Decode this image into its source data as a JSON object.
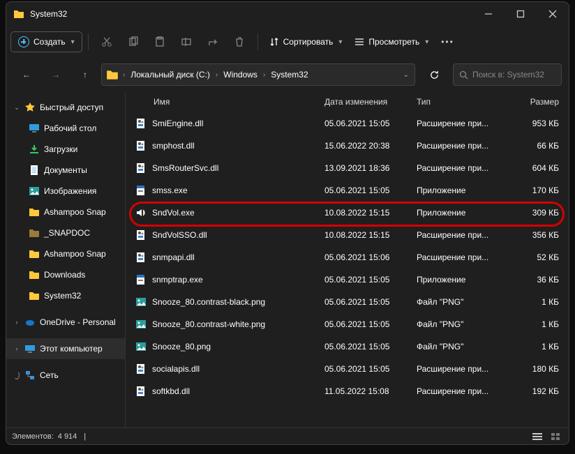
{
  "title": "System32",
  "cmd": {
    "create": "Создать",
    "sort": "Сортировать",
    "view": "Просмотреть"
  },
  "breadcrumbs": [
    "Локальный диск (C:)",
    "Windows",
    "System32"
  ],
  "search_placeholder": "Поиск в: System32",
  "cols": {
    "name": "Имя",
    "date": "Дата изменения",
    "type": "Тип",
    "size": "Размер"
  },
  "sidebar": {
    "quick": "Быстрый доступ",
    "items": [
      {
        "label": "Рабочий стол",
        "icon": "desktop"
      },
      {
        "label": "Загрузки",
        "icon": "download"
      },
      {
        "label": "Документы",
        "icon": "document"
      },
      {
        "label": "Изображения",
        "icon": "image"
      },
      {
        "label": "Ashampoo Snap",
        "icon": "folder"
      },
      {
        "label": "_SNAPDOC",
        "icon": "folder-dark"
      },
      {
        "label": "Ashampoo Snap",
        "icon": "folder"
      },
      {
        "label": "Downloads",
        "icon": "folder"
      },
      {
        "label": "System32",
        "icon": "folder"
      }
    ],
    "onedrive": "OneDrive - Personal",
    "thispc": "Этот компьютер",
    "network": "Сеть"
  },
  "files": [
    {
      "name": "SmiEngine.dll",
      "date": "05.06.2021 15:05",
      "type": "Расширение при...",
      "size": "953 КБ",
      "icon": "dll"
    },
    {
      "name": "smphost.dll",
      "date": "15.06.2022 20:38",
      "type": "Расширение при...",
      "size": "66 КБ",
      "icon": "dll"
    },
    {
      "name": "SmsRouterSvc.dll",
      "date": "13.09.2021 18:36",
      "type": "Расширение при...",
      "size": "604 КБ",
      "icon": "dll"
    },
    {
      "name": "smss.exe",
      "date": "05.06.2021 15:05",
      "type": "Приложение",
      "size": "170 КБ",
      "icon": "exe"
    },
    {
      "name": "SndVol.exe",
      "date": "10.08.2022 15:15",
      "type": "Приложение",
      "size": "309 КБ",
      "icon": "speaker"
    },
    {
      "name": "SndVolSSO.dll",
      "date": "10.08.2022 15:15",
      "type": "Расширение при...",
      "size": "356 КБ",
      "icon": "dll"
    },
    {
      "name": "snmpapi.dll",
      "date": "05.06.2021 15:06",
      "type": "Расширение при...",
      "size": "52 КБ",
      "icon": "dll"
    },
    {
      "name": "snmptrap.exe",
      "date": "05.06.2021 15:05",
      "type": "Приложение",
      "size": "36 КБ",
      "icon": "exe"
    },
    {
      "name": "Snooze_80.contrast-black.png",
      "date": "05.06.2021 15:05",
      "type": "Файл \"PNG\"",
      "size": "1 КБ",
      "icon": "png"
    },
    {
      "name": "Snooze_80.contrast-white.png",
      "date": "05.06.2021 15:05",
      "type": "Файл \"PNG\"",
      "size": "1 КБ",
      "icon": "png"
    },
    {
      "name": "Snooze_80.png",
      "date": "05.06.2021 15:05",
      "type": "Файл \"PNG\"",
      "size": "1 КБ",
      "icon": "png"
    },
    {
      "name": "socialapis.dll",
      "date": "05.06.2021 15:05",
      "type": "Расширение при...",
      "size": "180 КБ",
      "icon": "dll"
    },
    {
      "name": "softkbd.dll",
      "date": "11.05.2022 15:08",
      "type": "Расширение при...",
      "size": "192 КБ",
      "icon": "dll"
    }
  ],
  "status": {
    "label": "Элементов:",
    "count": "4 914"
  }
}
